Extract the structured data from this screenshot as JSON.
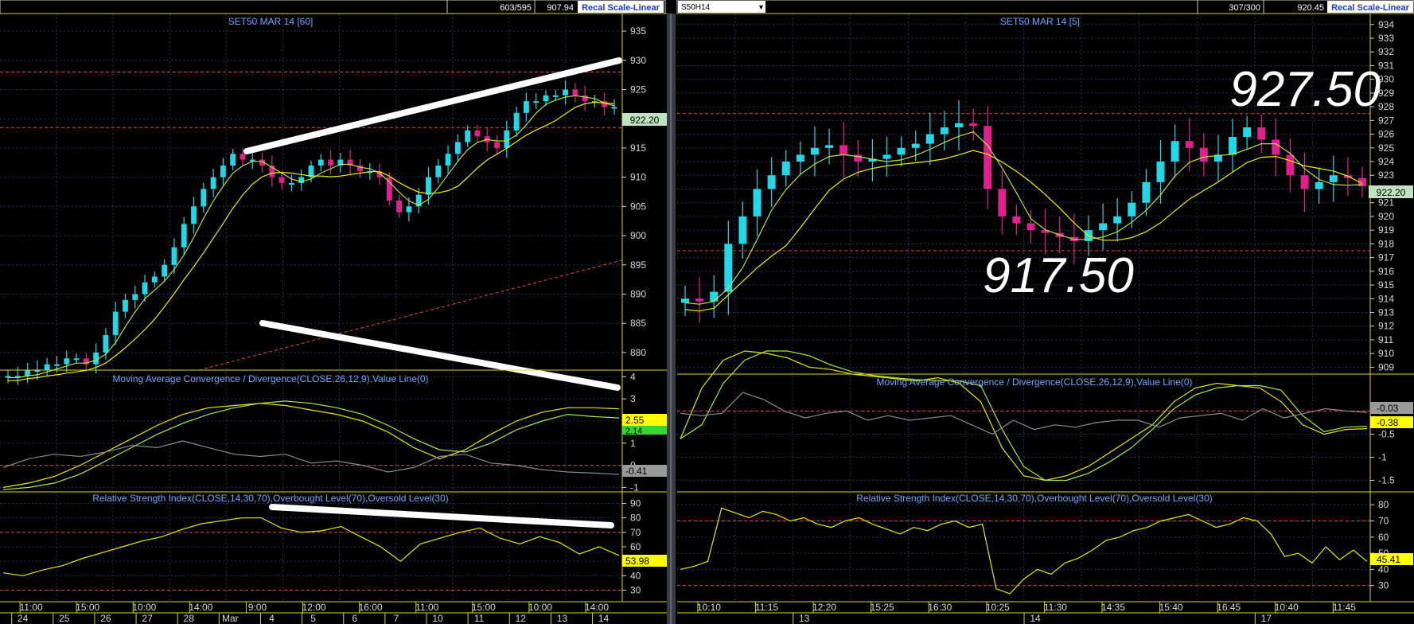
{
  "left": {
    "header": {
      "counter": "603/595",
      "price": "907.94",
      "button": "Recal Scale-Linear"
    },
    "price_title": "SET50 MAR 14   [60]",
    "price_axis": [
      "935",
      "930",
      "925",
      "920",
      "915",
      "910",
      "905",
      "900",
      "895",
      "890",
      "885",
      "880"
    ],
    "price_label": "922.20",
    "macd_title": "Moving Average Convergence / Divergence(CLOSE,26,12,9),Value Line(0)",
    "macd_axis": [
      "4",
      "3",
      "2",
      "1",
      "0",
      "-1"
    ],
    "macd_labels": [
      "2.55",
      "2.14",
      "-0.41"
    ],
    "rsi_title": "Relative Strength Index(CLOSE,14,30,70),Overbought Level(70),Oversold Level(30)",
    "rsi_axis": [
      "90",
      "80",
      "70",
      "60",
      "50",
      "40",
      "30"
    ],
    "rsi_label": "53.98",
    "time_labels": [
      "11:00",
      "15:00",
      "10:00",
      "14:00",
      "9:00",
      "12:00",
      "16:00",
      "11:00",
      "15:00",
      "10:00",
      "14:00"
    ],
    "date_labels": [
      "24",
      "25",
      "26",
      "27",
      "28",
      "Mar",
      "4",
      "5",
      "6",
      "7",
      "10",
      "11",
      "12",
      "13",
      "14"
    ]
  },
  "right": {
    "header": {
      "symbol": "S50H14",
      "counter": "307/300",
      "price": "920.45",
      "button": "Recal Scale-Linear"
    },
    "price_title": "SET50 MAR 14   [5]",
    "price_axis": [
      "934",
      "933",
      "932",
      "931",
      "930",
      "929",
      "928",
      "927",
      "926",
      "925",
      "924",
      "923",
      "922",
      "921",
      "920",
      "919",
      "918",
      "917",
      "916",
      "915",
      "914",
      "913",
      "912",
      "911",
      "910",
      "909"
    ],
    "price_label": "922.20",
    "annot_high": "927.50",
    "annot_low": "917.50",
    "macd_title": "Moving Average Convergence / Divergence(CLOSE,26,12,9),Value Line(0)",
    "macd_axis": [
      "0",
      "-0.5",
      "-1",
      "-1.5"
    ],
    "macd_labels": [
      "-0.03",
      "-0.38"
    ],
    "rsi_title": "Relative Strength Index(CLOSE,14,30,70),Overbought Level(70),Oversold Level(30)",
    "rsi_axis": [
      "80",
      "70",
      "60",
      "50",
      "40",
      "30"
    ],
    "rsi_label": "45.41",
    "time_labels": [
      "10:10",
      "11:15",
      "12:20",
      "15:25",
      "16:30",
      "10:25",
      "11:30",
      "14:35",
      "15:40",
      "16:45",
      "10:40",
      "11:45"
    ],
    "date_labels": [
      "13",
      "14",
      "17"
    ]
  },
  "chart_data": [
    {
      "type": "line",
      "title": "SET50 MAR 14   [60]",
      "note": "candlestick price panel (hourly)",
      "ylim": [
        877,
        938
      ],
      "x_ticks": [
        "11:00",
        "15:00",
        "10:00",
        "14:00",
        "9:00",
        "12:00",
        "16:00",
        "11:00",
        "15:00",
        "10:00",
        "14:00"
      ],
      "y": [
        876,
        876,
        877,
        877,
        878,
        878,
        879,
        879,
        878,
        880,
        883,
        887,
        889,
        890,
        892,
        893,
        895,
        898,
        902,
        905,
        908,
        910,
        912,
        914,
        913,
        913,
        912,
        910,
        909,
        909,
        910,
        912,
        913,
        912,
        913,
        912,
        911,
        911,
        910,
        906,
        904,
        905,
        907,
        910,
        912,
        914,
        916,
        918,
        917,
        916,
        915,
        918,
        921,
        923,
        923,
        924,
        924,
        925,
        924,
        923,
        923,
        922,
        922
      ]
    },
    {
      "type": "line",
      "title": "Moving Average Convergence / Divergence(CLOSE,26,12,9),Value Line(0)",
      "ylim": [
        -1.2,
        4.3
      ],
      "series": [
        {
          "name": "",
          "y": [
            -1,
            -0.8,
            -0.5,
            0,
            0.6,
            1.2,
            1.8,
            2.3,
            2.6,
            2.7,
            2.8,
            2.7,
            2.5,
            2.3,
            2.0,
            1.5,
            0.8,
            0.3,
            0.7,
            1.4,
            2.0,
            2.4,
            2.6,
            2.6,
            2.55
          ]
        },
        {
          "name": "",
          "y": [
            -1.1,
            -1,
            -0.8,
            -0.4,
            0.2,
            0.8,
            1.4,
            1.9,
            2.3,
            2.6,
            2.8,
            2.9,
            2.8,
            2.6,
            2.3,
            1.8,
            1.2,
            0.7,
            0.6,
            1.0,
            1.6,
            2.0,
            2.3,
            2.2,
            2.14
          ]
        },
        {
          "name": "",
          "y": [
            -0.1,
            0.3,
            0.5,
            0.4,
            0.6,
            0.9,
            0.8,
            1.1,
            0.8,
            0.5,
            0.4,
            0.5,
            0.1,
            0.2,
            0.0,
            -0.3,
            -0.1,
            0.4,
            0.5,
            0.1,
            0.0,
            -0.2,
            -0.3,
            -0.35,
            -0.41
          ]
        }
      ]
    },
    {
      "type": "line",
      "title": "Relative Strength Index(CLOSE,14,30,70),Overbought Level(70),Oversold Level(30)",
      "ylim": [
        22,
        98
      ],
      "y": [
        42,
        40,
        44,
        47,
        52,
        56,
        60,
        64,
        67,
        72,
        76,
        78,
        80,
        80,
        73,
        70,
        71,
        74,
        67,
        60,
        50,
        62,
        66,
        70,
        73,
        66,
        62,
        67,
        63,
        55,
        60,
        54
      ]
    },
    {
      "type": "line",
      "title": "SET50 MAR 14   [5]",
      "note": "candlestick price panel (5 min)",
      "ylim": [
        908.5,
        934.8
      ],
      "x_ticks": [
        "10:10",
        "11:15",
        "12:20",
        "15:25",
        "16:30",
        "10:25",
        "11:30",
        "14:35",
        "15:40",
        "16:45",
        "10:40",
        "11:45"
      ],
      "annotations": [
        "927.50",
        "917.50"
      ],
      "y": [
        914,
        913.8,
        914.5,
        918,
        920,
        922,
        923,
        924,
        924.5,
        925,
        925.2,
        924.5,
        924,
        924.2,
        924.5,
        925,
        925.3,
        926,
        926.5,
        926.8,
        926.6,
        922,
        920,
        919.5,
        919,
        918.8,
        918.5,
        918.2,
        919,
        919.5,
        920,
        921,
        922.5,
        924,
        925.5,
        925,
        924,
        924.5,
        925.8,
        926.5,
        925.6,
        924.5,
        923,
        922,
        922.5,
        923,
        922.8,
        922.2
      ]
    },
    {
      "type": "line",
      "title": "Moving Average Convergence / Divergence(CLOSE,26,12,9),Value Line(0)",
      "ylim": [
        -1.75,
        0.8
      ],
      "series": [
        {
          "name": "",
          "y": [
            -0.6,
            0.5,
            1.1,
            1.3,
            1.25,
            1.15,
            0.95,
            0.9,
            0.8,
            0.75,
            0.7,
            0.65,
            0.72,
            0.6,
            0.2,
            -0.8,
            -1.4,
            -1.5,
            -1.4,
            -1.2,
            -0.9,
            -0.6,
            -0.3,
            0.2,
            0.5,
            0.6,
            0.55,
            0.5,
            0.2,
            -0.3,
            -0.5,
            -0.4,
            -0.38
          ]
        },
        {
          "name": "",
          "y": [
            -0.6,
            -0.3,
            0.6,
            1.1,
            1.3,
            1.3,
            1.2,
            1.0,
            0.85,
            0.77,
            0.72,
            0.68,
            0.66,
            0.65,
            0.55,
            -0.4,
            -1.2,
            -1.5,
            -1.5,
            -1.35,
            -1.1,
            -0.8,
            -0.4,
            0.05,
            0.35,
            0.5,
            0.55,
            0.55,
            0.45,
            -0.1,
            -0.45,
            -0.35,
            -0.33
          ]
        },
        {
          "name": "",
          "y": [
            -0.05,
            -0.1,
            -0.05,
            0.4,
            0.25,
            0,
            -0.15,
            -0.05,
            0,
            -0.2,
            -0.1,
            -0.2,
            -0.15,
            -0.1,
            -0.3,
            -0.5,
            -0.2,
            -0.4,
            -0.3,
            -0.35,
            -0.25,
            -0.2,
            -0.2,
            -0.35,
            -0.15,
            -0.1,
            -0.05,
            -0.2,
            0.05,
            -0.15,
            -0.05,
            0.05,
            0,
            -0.03
          ]
        }
      ]
    },
    {
      "type": "line",
      "title": "Relative Strength Index(CLOSE,14,30,70),Overbought Level(70),Oversold Level(30)",
      "ylim": [
        20,
        88
      ],
      "y": [
        40,
        42,
        45,
        78,
        75,
        72,
        76,
        74,
        70,
        72,
        68,
        66,
        70,
        72,
        68,
        65,
        62,
        66,
        64,
        68,
        70,
        66,
        68,
        28,
        25,
        34,
        40,
        37,
        44,
        47,
        52,
        58,
        60,
        64,
        66,
        70,
        72,
        74,
        70,
        66,
        68,
        72,
        70,
        62,
        48,
        50,
        44,
        54,
        46,
        52,
        45
      ]
    }
  ]
}
